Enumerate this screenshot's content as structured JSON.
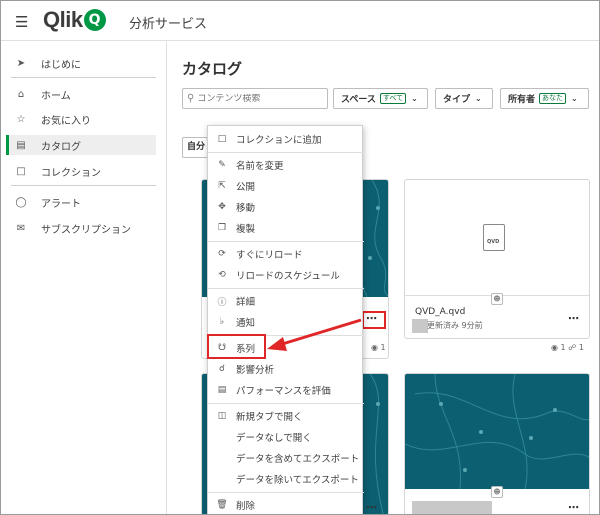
{
  "header": {
    "menu_icon": "hamburger-icon",
    "logo_text": "Qlik",
    "logo_mark": "Q",
    "app_title": "分析サービス"
  },
  "sidebar": {
    "items": [
      {
        "label": "はじめに",
        "icon": "rocket-icon"
      },
      {
        "label": "ホーム",
        "icon": "home-icon"
      },
      {
        "label": "お気に入り",
        "icon": "star-icon"
      },
      {
        "label": "カタログ",
        "icon": "catalog-icon",
        "active": true
      },
      {
        "label": "コレクション",
        "icon": "bookmark-icon"
      },
      {
        "label": "アラート",
        "icon": "alert-icon"
      },
      {
        "label": "サブスクリプション",
        "icon": "mail-icon"
      }
    ]
  },
  "main": {
    "title": "カタログ",
    "search_placeholder": "コンテンツ検索",
    "filters": {
      "space_label": "スペース",
      "space_chip": "すべて",
      "type_label": "タイプ",
      "owner_label": "所有者",
      "owner_chip": "あなた"
    },
    "own_button_label": "自分"
  },
  "cards": {
    "qvd": {
      "icon_label": "QVD",
      "name": "QVD_A.qvd",
      "updated": "更新済み 9分前",
      "views": "1",
      "links": "1"
    },
    "left_views": "1"
  },
  "menu": {
    "items": [
      {
        "label": "コレクションに追加",
        "icon": "bookmark-icon"
      },
      {
        "label": "名前を変更",
        "icon": "pencil-icon"
      },
      {
        "label": "公開",
        "icon": "publish-icon"
      },
      {
        "label": "移動",
        "icon": "move-icon"
      },
      {
        "label": "複製",
        "icon": "duplicate-icon"
      },
      {
        "label": "すぐにリロード",
        "icon": "reload-icon"
      },
      {
        "label": "リロードのスケジュール",
        "icon": "schedule-icon"
      },
      {
        "label": "詳細",
        "icon": "info-icon"
      },
      {
        "label": "通知",
        "icon": "bell-icon"
      },
      {
        "label": "系列",
        "icon": "lineage-icon"
      },
      {
        "label": "影響分析",
        "icon": "impact-icon"
      },
      {
        "label": "パフォーマンスを評価",
        "icon": "performance-icon"
      },
      {
        "label": "新規タブで開く",
        "icon": "new-tab-icon"
      },
      {
        "label": "データなしで開く",
        "icon": ""
      },
      {
        "label": "データを含めてエクスポート",
        "icon": ""
      },
      {
        "label": "データを除いてエクスポート",
        "icon": ""
      },
      {
        "label": "削除",
        "icon": "trash-icon"
      }
    ]
  },
  "colors": {
    "brand_green": "#009845",
    "thumbnail_teal": "#0b5f70",
    "annotation_red": "#e02626"
  }
}
